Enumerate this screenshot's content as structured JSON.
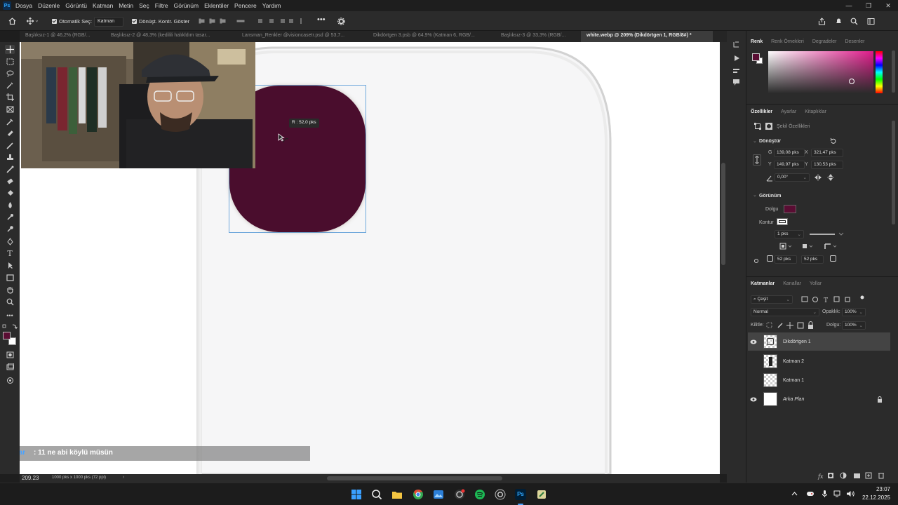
{
  "menubar": {
    "app_icon": "Ps",
    "items": [
      "Dosya",
      "Düzenle",
      "Görüntü",
      "Katman",
      "Metin",
      "Seç",
      "Filtre",
      "Görünüm",
      "Eklentiler",
      "Pencere",
      "Yardım"
    ],
    "window_controls": [
      "—",
      "❐",
      "✕"
    ]
  },
  "options": {
    "auto_select_label": "Otomatik Seç:",
    "auto_select_value": "Katman",
    "transform_label": "Dönüşt. Kontr. Göster",
    "more": "•••"
  },
  "tabs": [
    {
      "label": "Başlıksız-1 @ 46,2% (RGB/...",
      "active": false
    },
    {
      "label": "Başlıksız-2 @ 48,3% (kedilili halıkldım tasar...",
      "active": false
    },
    {
      "label": "Lansman_Renkler @visioncasetr.psd @ 53,7...",
      "active": false
    },
    {
      "label": "Dikdörtgen 3.psb @ 64,9% (Katman 6, RGB/...",
      "active": false
    },
    {
      "label": "Başlıksız-3 @ 33,3% (RGB/...",
      "active": false
    },
    {
      "label": "white.webp @ 209% (Dikdörtgen 1, RGB/8#) *",
      "active": true
    }
  ],
  "canvas": {
    "tooltip": "R : 52,0 pks",
    "shape_color": "#4a0d2d",
    "chat_user": "pazar",
    "chat_message": ": 11 ne abi köylü müsün"
  },
  "status": {
    "zoom": "209.23",
    "doc_size": "1000 pks x 1000 pks (72 ppi)"
  },
  "color_panel": {
    "tabs": [
      "Renk",
      "Renk Örnekleri",
      "Degradeler",
      "Desenler"
    ],
    "fg_color": "#5a0d33",
    "bg_color": "#ffffff"
  },
  "properties": {
    "tabs": [
      "Özellikler",
      "Ayarlar",
      "Kitaplıklar"
    ],
    "title": "Şekil Özellikleri",
    "transform_header": "Dönüştür",
    "w_label": "G",
    "w_value": "139,08 pks",
    "x_label": "X",
    "x_value": "321,47 pks",
    "h_label": "Y",
    "h_value": "149,97 pks",
    "y_label": "Y",
    "y_value": "130,53 pks",
    "angle": "0,00°",
    "appearance_header": "Görünüm",
    "fill_label": "Dolgu",
    "stroke_label": "Kontur",
    "stroke_width": "1 pks",
    "radius_1": "52 pks",
    "radius_2": "52 pks"
  },
  "layers_panel": {
    "tabs": [
      "Katmanlar",
      "Kanallar",
      "Yollar"
    ],
    "filter": "Çeşit",
    "blend_mode": "Normal",
    "opacity_label": "Opaklık:",
    "opacity_value": "100%",
    "lock_label": "Kilitle:",
    "fill_label": "Dolgu:",
    "fill_value": "100%",
    "layers": [
      {
        "name": "Dikdörtgen 1",
        "visible": true,
        "selected": true
      },
      {
        "name": "Katman 2",
        "visible": false,
        "selected": false
      },
      {
        "name": "Katman 1",
        "visible": false,
        "selected": false
      },
      {
        "name": "Arka Plan",
        "visible": true,
        "selected": false,
        "locked": true
      }
    ]
  },
  "taskbar": {
    "time": "23:07",
    "date": "22.12.2025"
  }
}
